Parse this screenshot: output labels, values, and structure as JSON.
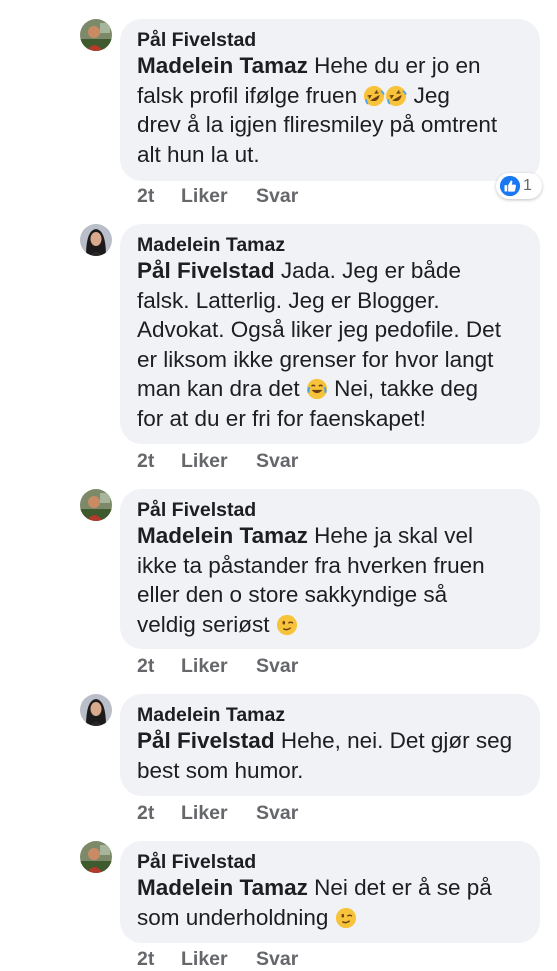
{
  "comments": [
    {
      "author": "Pål Fivelstad",
      "avatar": "avatar-pal",
      "mention": "Madelein Tamaz",
      "lines": [
        "Hehe du er jo en",
        "falsk profil ifølge fruen",
        "Jeg",
        "drev å la igjen fliresmiley på omtrent",
        "alt hun la ut."
      ],
      "emoji": [
        "rofl-emoji",
        "rofl-emoji"
      ],
      "time": "2t",
      "like": "Liker",
      "reply": "Svar",
      "reaction_icon": "like-reaction-icon",
      "reaction_count": "1"
    },
    {
      "author": "Madelein Tamaz",
      "avatar": "avatar-madelein",
      "mention": "Pål Fivelstad",
      "lines": [
        "Jada. Jeg er både",
        "falsk. Latterlig. Jeg er Blogger.",
        "Advokat. Også liker jeg pedofile. Det",
        "er liksom ikke grenser for hvor langt",
        "man kan dra det",
        "Nei, takke deg",
        "for at du er fri for faenskapet!"
      ],
      "emoji": [
        "tears-of-joy-emoji"
      ],
      "time": "2t",
      "like": "Liker",
      "reply": "Svar"
    },
    {
      "author": "Pål Fivelstad",
      "avatar": "avatar-pal",
      "mention": "Madelein Tamaz",
      "lines": [
        "Hehe ja skal vel",
        "ikke ta påstander fra hverken fruen",
        "eller den o store sakkyndige så",
        "veldig seriøst"
      ],
      "emoji": [
        "wink-emoji"
      ],
      "time": "2t",
      "like": "Liker",
      "reply": "Svar"
    },
    {
      "author": "Madelein Tamaz",
      "avatar": "avatar-madelein",
      "mention": "Pål Fivelstad",
      "lines": [
        "Hehe, nei. Det gjør seg",
        "best som humor."
      ],
      "time": "2t",
      "like": "Liker",
      "reply": "Svar"
    },
    {
      "author": "Pål Fivelstad",
      "avatar": "avatar-pal",
      "mention": "Madelein Tamaz",
      "lines": [
        "Nei det er å se på",
        "som underholdning"
      ],
      "emoji": [
        "wink-emoji"
      ],
      "time": "2t",
      "like": "Liker",
      "reply": "Svar"
    }
  ],
  "colors": {
    "bubble": "#f0f2f5",
    "text": "#1c1e21",
    "meta": "#65676b",
    "like_blue": "#1877f2"
  }
}
